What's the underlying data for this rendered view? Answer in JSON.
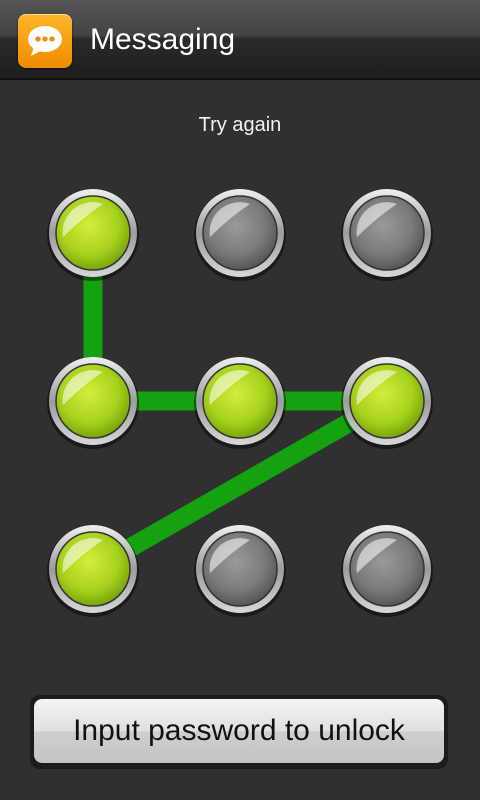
{
  "header": {
    "title": "Messaging",
    "app_icon": "speech-bubble-icon",
    "icon_color": "#f5a00f"
  },
  "status": {
    "message": "Try again"
  },
  "pattern": {
    "grid_rows": 3,
    "grid_cols": 3,
    "active_color": "#a9d41f",
    "inactive_color": "#7a7a7a",
    "line_color": "#14a30e",
    "sequence": [
      1,
      4,
      5,
      6,
      7
    ],
    "dots": [
      {
        "index": 1,
        "active": true
      },
      {
        "index": 2,
        "active": false
      },
      {
        "index": 3,
        "active": false
      },
      {
        "index": 4,
        "active": true
      },
      {
        "index": 5,
        "active": true
      },
      {
        "index": 6,
        "active": true
      },
      {
        "index": 7,
        "active": true
      },
      {
        "index": 8,
        "active": false
      },
      {
        "index": 9,
        "active": false
      }
    ]
  },
  "unlock_button": {
    "label": "Input password to unlock"
  }
}
